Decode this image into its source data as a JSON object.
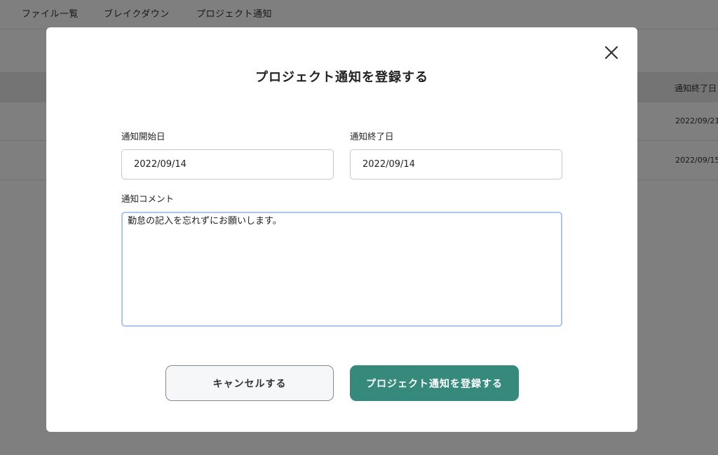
{
  "nav": {
    "items": [
      {
        "label": "ファイル一覧"
      },
      {
        "label": "ブレイクダウン"
      },
      {
        "label": "プロジェクト通知"
      }
    ]
  },
  "table": {
    "header_end_date": "通知終了日",
    "rows": [
      {
        "end_date": "2022/09/21"
      },
      {
        "end_date": "2022/09/15"
      }
    ]
  },
  "modal": {
    "title": "プロジェクト通知を登録する",
    "close_icon": "close-x-icon",
    "start_date_label": "通知開始日",
    "start_date_value": "2022/09/14",
    "end_date_label": "通知終了日",
    "end_date_value": "2022/09/14",
    "comment_label": "通知コメント",
    "comment_value": "勤怠の記入を忘れずにお願いします。",
    "cancel_label": "キャンセルする",
    "submit_label": "プロジェクト通知を登録する"
  },
  "colors": {
    "accent": "#358a7c",
    "overlay": "rgba(0,0,0,0.5)",
    "focus_border": "#a9c6f0"
  }
}
